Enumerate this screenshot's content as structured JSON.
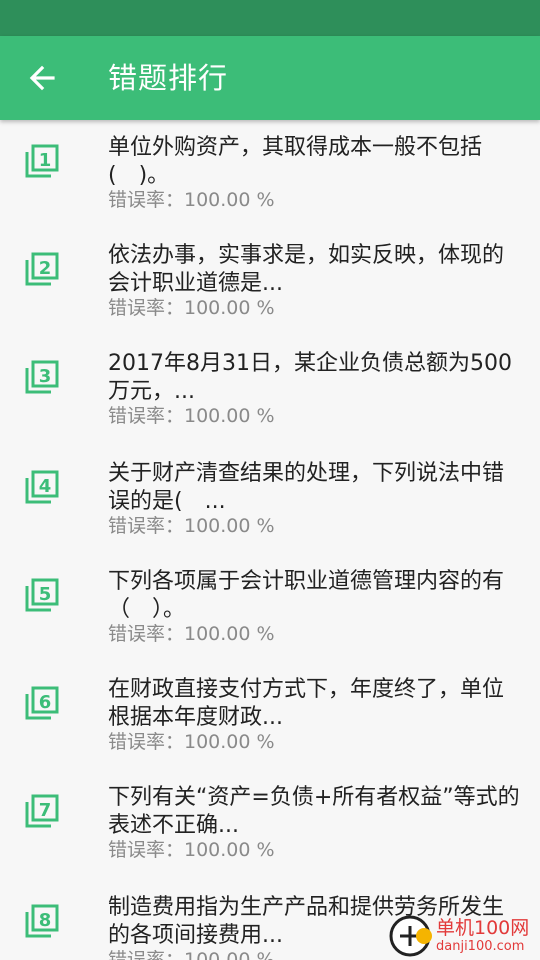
{
  "status_bar": {},
  "app_bar": {
    "back_icon": "arrow-left-icon",
    "title": "错题排行"
  },
  "accent_color": "#3cbd78",
  "list": {
    "items": [
      {
        "rank": "1",
        "icon": "rank-1-icon",
        "text": "单位外购资产，其取得成本一般不包括(　)。",
        "rate": "错误率：100.00 %"
      },
      {
        "rank": "2",
        "icon": "rank-2-icon",
        "text": "依法办事，实事求是，如实反映，体现的会计职业道德是...",
        "rate": "错误率：100.00 %"
      },
      {
        "rank": "3",
        "icon": "rank-3-icon",
        "text": "2017年8月31日，某企业负债总额为500万元，...",
        "rate": "错误率：100.00 %"
      },
      {
        "rank": "4",
        "icon": "rank-4-icon",
        "text": "关于财产清查结果的处理，下列说法中错误的是(　...",
        "rate": "错误率：100.00 %"
      },
      {
        "rank": "5",
        "icon": "rank-5-icon",
        "text": "下列各项属于会计职业道德管理内容的有（　）。",
        "rate": "错误率：100.00 %"
      },
      {
        "rank": "6",
        "icon": "rank-6-icon",
        "text": "在财政直接支付方式下，年度终了，单位根据本年度财政...",
        "rate": "错误率：100.00 %"
      },
      {
        "rank": "7",
        "icon": "rank-7-icon",
        "text": "下列有关“资产=负债+所有者权益”等式的表述不正确...",
        "rate": "错误率：100.00 %"
      },
      {
        "rank": "8",
        "icon": "rank-8-icon",
        "text": "制造费用指为生产产品和提供劳务所发生的各项间接费用...",
        "rate": "错误率：100.00 %"
      }
    ]
  },
  "watermark": {
    "name": "单机100网",
    "url": "danji100.com"
  }
}
